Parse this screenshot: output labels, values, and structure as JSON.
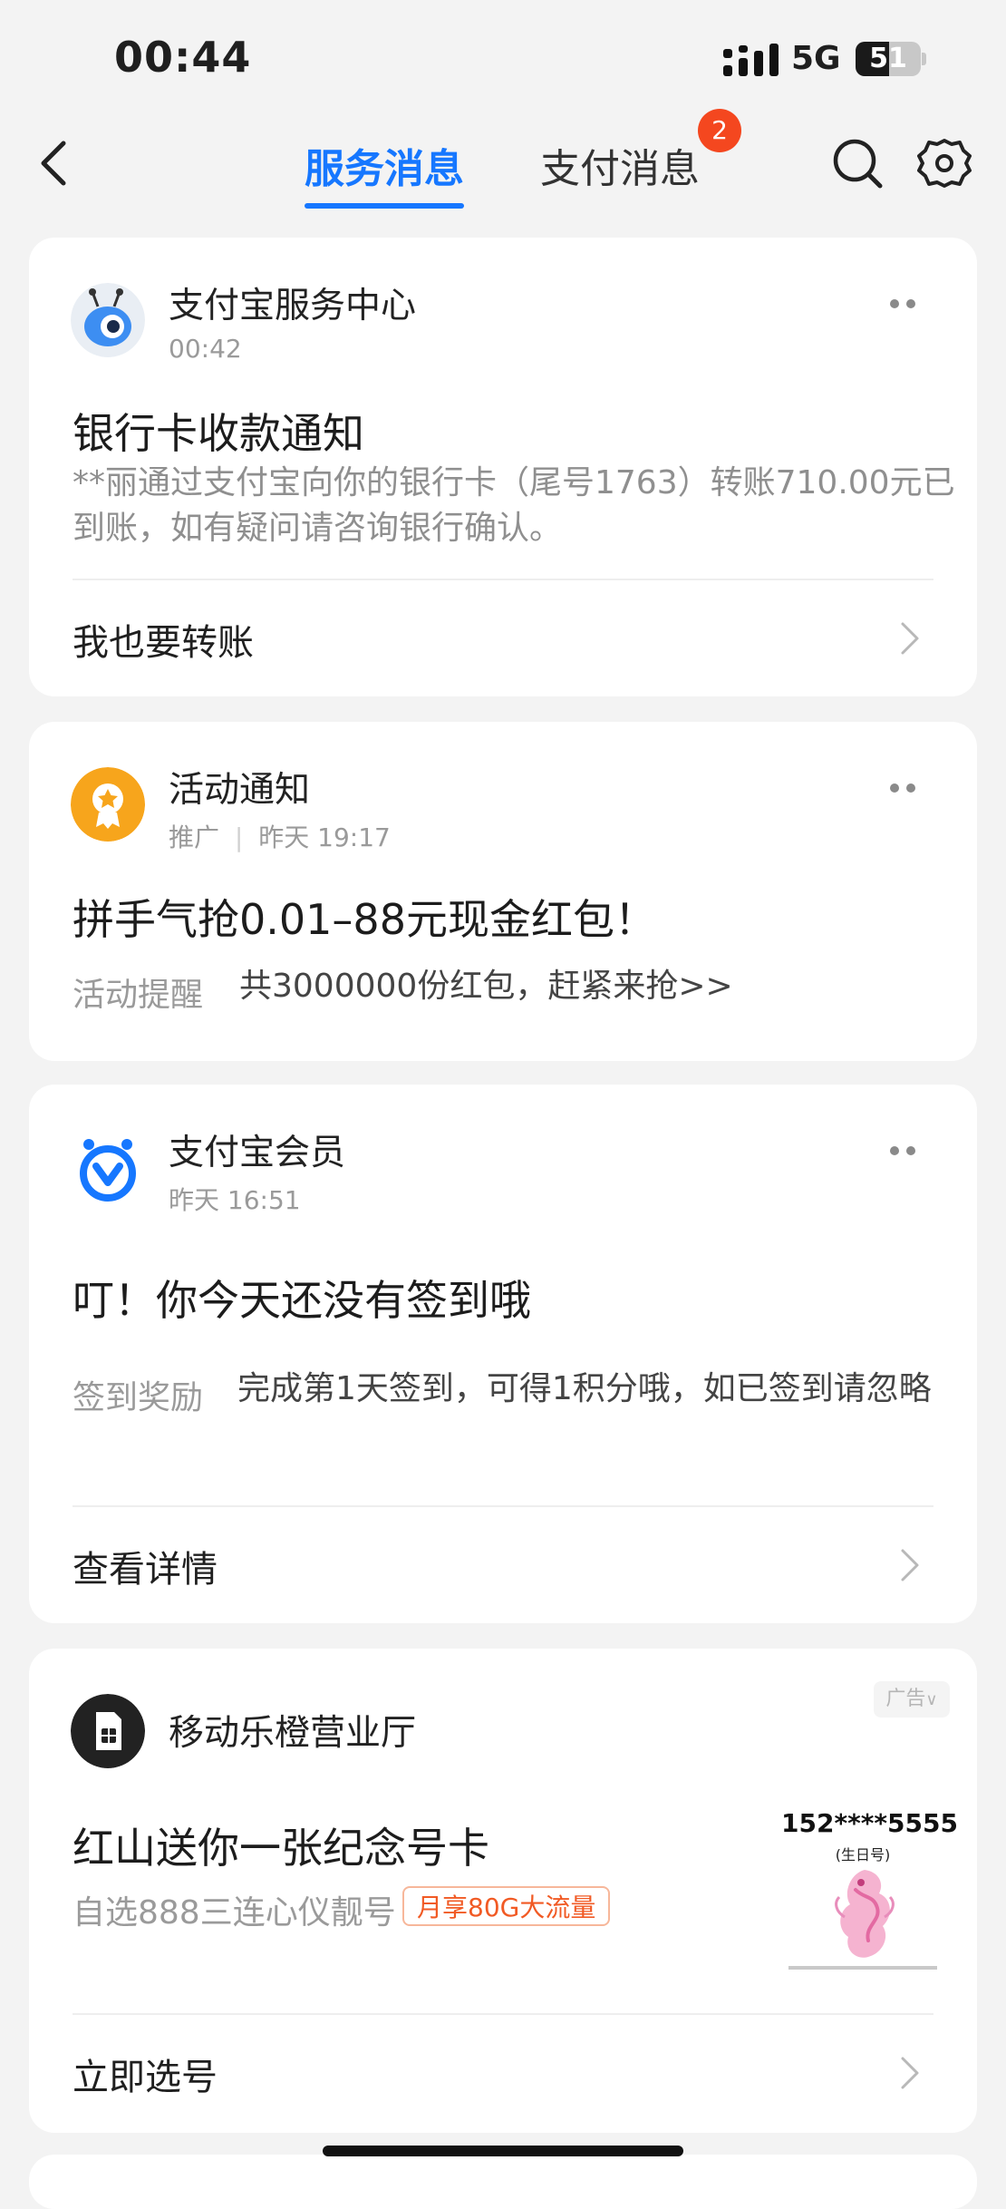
{
  "status": {
    "time": "00:44",
    "network": "5G",
    "battery": "51",
    "battery_level": 0.51
  },
  "nav": {
    "tabs": [
      {
        "label": "服务消息",
        "active": true
      },
      {
        "label": "支付消息",
        "active": false,
        "badge": "2"
      }
    ]
  },
  "cards": [
    {
      "sender": "支付宝服务中心",
      "time": "00:42",
      "headline": "银行卡收款通知",
      "body": "**丽通过支付宝向你的银行卡（尾号1763）转账710.00元已到账，如有疑问请咨询银行确认。",
      "action": "我也要转账"
    },
    {
      "sender": "活动通知",
      "tag": "推广",
      "time": "昨天 19:17",
      "headline": "拼手气抢0.01–88元现金红包！",
      "label": "活动提醒",
      "value": "共3000000份红包，赶紧来抢>>"
    },
    {
      "sender": "支付宝会员",
      "time": "昨天 16:51",
      "headline": "叮！你今天还没有签到哦",
      "label": "签到奖励",
      "value": "完成第1天签到，可得1积分哦，如已签到请忽略",
      "action": "查看详情"
    },
    {
      "sender": "移动乐橙营业厅",
      "ad_label": "广告",
      "headline": "红山送你一张纪念号卡",
      "subtext": "自选888三连心仪靓号",
      "promo": "月享80G大流量",
      "phone_number": "152****5555",
      "number_type": "(生日号)",
      "action": "立即选号"
    }
  ],
  "colors": {
    "accent": "#1677ff",
    "badge": "#f4471f",
    "promo": "#f15a24",
    "activity_icon": "#f7a51c"
  }
}
